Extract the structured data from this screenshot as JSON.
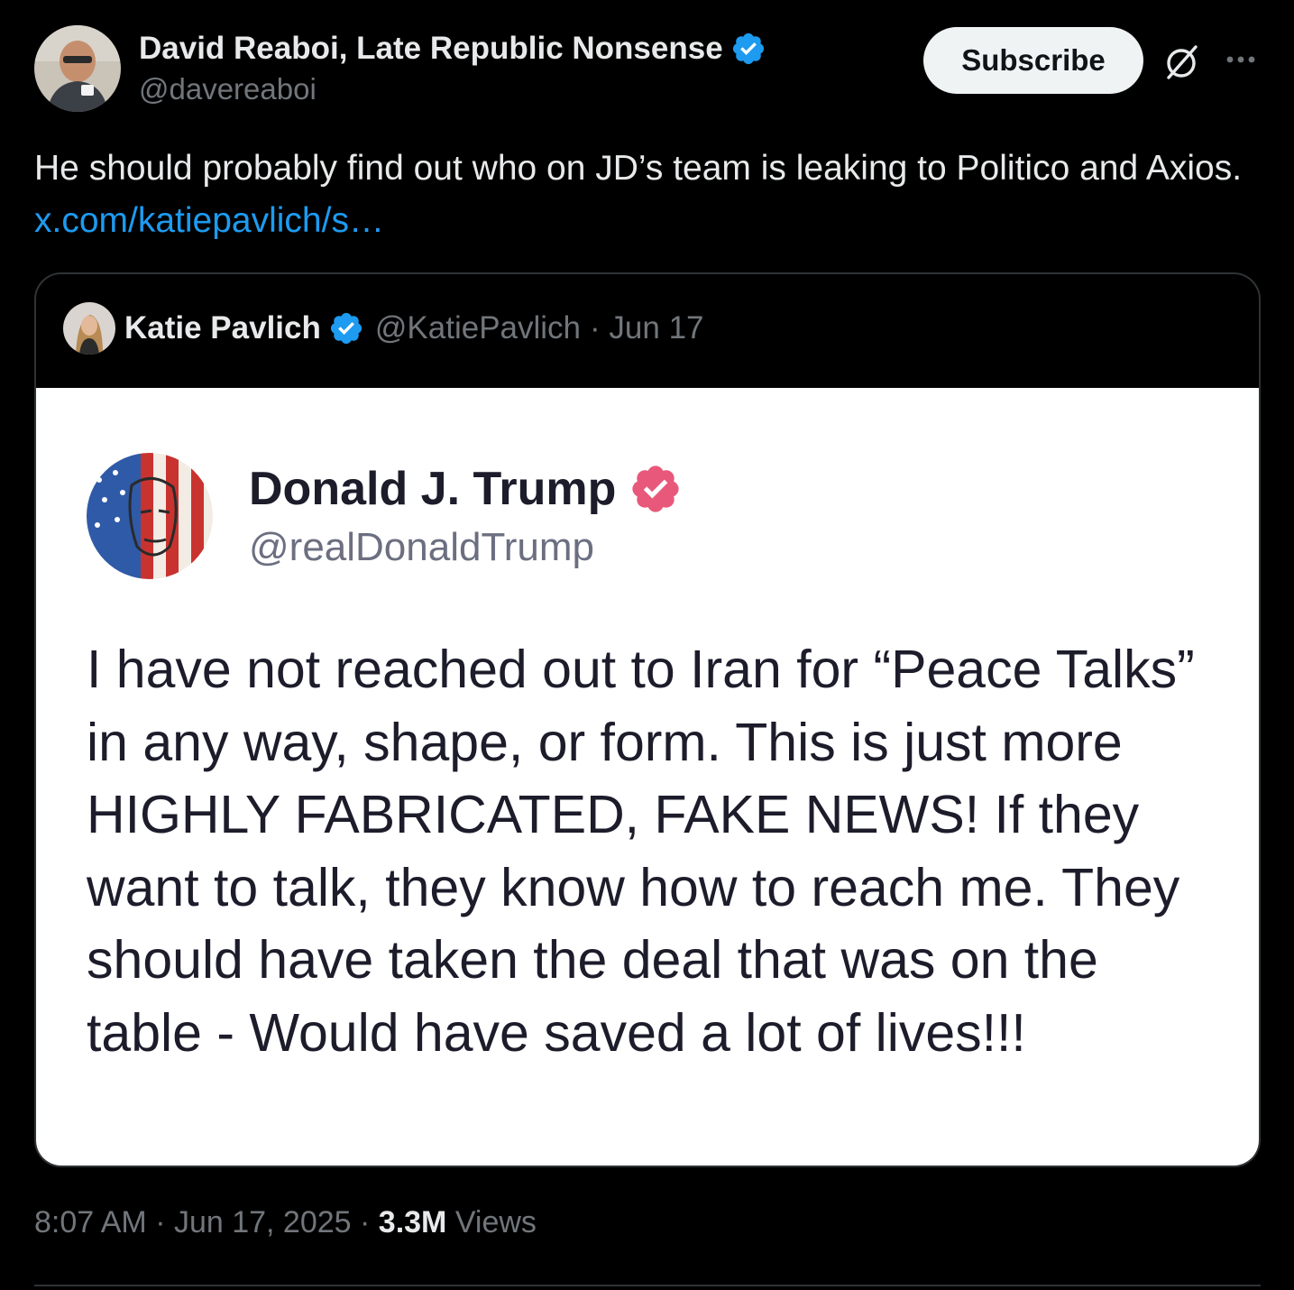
{
  "author": {
    "display_name": "David Reaboi, Late Republic Nonsense",
    "handle": "@davereaboi",
    "verified_icon": "verified-badge-icon"
  },
  "actions": {
    "subscribe_label": "Subscribe",
    "grok_icon": "grok-icon",
    "more_icon": "more-icon"
  },
  "tweet": {
    "text": "He should probably find out who on JD’s team is leaking to Politico and Axios. ",
    "link": "x.com/katiepavlich/s…"
  },
  "quote": {
    "display_name": "Katie Pavlich",
    "handle": "@KatiePavlich",
    "date": "· Jun 17",
    "image": {
      "name": "Donald J. Trump",
      "handle": "@realDonaldTrump",
      "text": "I have not reached out to Iran for “Peace Talks” in any way, shape, or form. This is just more HIGHLY FABRICATED, FAKE NEWS! If they want to talk, they know how to reach me. They should have taken the deal that was on the table - Would have saved a lot of lives!!!"
    }
  },
  "footer": {
    "time": "8:07 AM · Jun 17, 2025 · ",
    "views_count": "3.3M",
    "views_label": " Views"
  },
  "colors": {
    "background": "#000000",
    "link": "#1d9bf0",
    "verified": "#1d9bf0",
    "truth_badge": "#e8587a",
    "secondary_text": "#71767b"
  }
}
